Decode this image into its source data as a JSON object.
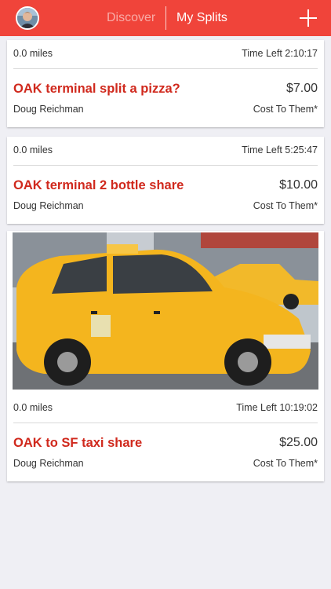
{
  "header": {
    "tabs": [
      {
        "label": "Discover",
        "active": false
      },
      {
        "label": "My Splits",
        "active": true
      }
    ],
    "add_icon": "plus-icon",
    "avatar_icon": "user-avatar",
    "colors": {
      "accent": "#f0443a",
      "title": "#d0291d"
    }
  },
  "splits": [
    {
      "distance": "0.0 miles",
      "time_left": "Time Left 2:10:17",
      "title": "OAK terminal split a pizza?",
      "price": "$7.00",
      "owner": "Doug Reichman",
      "cost_label": "Cost To Them*",
      "has_image": false
    },
    {
      "distance": "0.0 miles",
      "time_left": "Time Left 5:25:47",
      "title": "OAK terminal 2 bottle share",
      "price": "$10.00",
      "owner": "Doug Reichman",
      "cost_label": "Cost To Them*",
      "has_image": false
    },
    {
      "distance": "0.0 miles",
      "time_left": "Time Left 10:19:02",
      "title": "OAK to SF taxi share",
      "price": "$25.00",
      "owner": "Doug Reichman",
      "cost_label": "Cost To Them*",
      "has_image": true,
      "image_icon": "taxi-photo"
    }
  ]
}
